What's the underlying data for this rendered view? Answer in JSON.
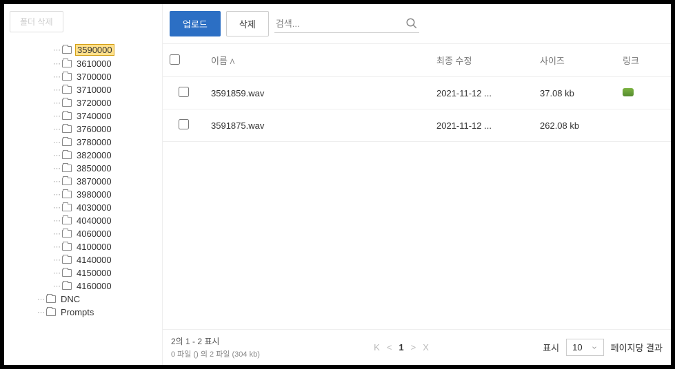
{
  "toolbar": {
    "delete_folder_label": "폴더 삭제",
    "upload_label": "업로드",
    "delete_label": "삭제",
    "search_placeholder": "검색..."
  },
  "tree": {
    "items": [
      {
        "label": "3590000",
        "selected": true,
        "nested": true
      },
      {
        "label": "3610000",
        "selected": false,
        "nested": true
      },
      {
        "label": "3700000",
        "selected": false,
        "nested": true
      },
      {
        "label": "3710000",
        "selected": false,
        "nested": true
      },
      {
        "label": "3720000",
        "selected": false,
        "nested": true
      },
      {
        "label": "3740000",
        "selected": false,
        "nested": true
      },
      {
        "label": "3760000",
        "selected": false,
        "nested": true
      },
      {
        "label": "3780000",
        "selected": false,
        "nested": true
      },
      {
        "label": "3820000",
        "selected": false,
        "nested": true
      },
      {
        "label": "3850000",
        "selected": false,
        "nested": true
      },
      {
        "label": "3870000",
        "selected": false,
        "nested": true
      },
      {
        "label": "3980000",
        "selected": false,
        "nested": true
      },
      {
        "label": "4030000",
        "selected": false,
        "nested": true
      },
      {
        "label": "4040000",
        "selected": false,
        "nested": true
      },
      {
        "label": "4060000",
        "selected": false,
        "nested": true
      },
      {
        "label": "4100000",
        "selected": false,
        "nested": true
      },
      {
        "label": "4140000",
        "selected": false,
        "nested": true
      },
      {
        "label": "4150000",
        "selected": false,
        "nested": true
      },
      {
        "label": "4160000",
        "selected": false,
        "nested": true
      },
      {
        "label": "DNC",
        "selected": false,
        "nested": false
      },
      {
        "label": "Prompts",
        "selected": false,
        "nested": false
      }
    ]
  },
  "table": {
    "headers": {
      "name": "이름",
      "modified": "최종 수정",
      "size": "사이즈",
      "link": "링크"
    },
    "rows": [
      {
        "name": "3591859.wav",
        "modified": "2021-11-12 ...",
        "size": "37.08 kb",
        "has_link": true
      },
      {
        "name": "3591875.wav",
        "modified": "2021-11-12 ...",
        "size": "262.08 kb",
        "has_link": false
      }
    ]
  },
  "footer": {
    "showing": "2의 1 - 2 표시",
    "file_count": "0 파일 () 의 2 파일 (304 kb)",
    "current_page": "1",
    "page_size_label": "표시",
    "page_size_value": "10",
    "results_per_page": "페이지당 결과"
  }
}
